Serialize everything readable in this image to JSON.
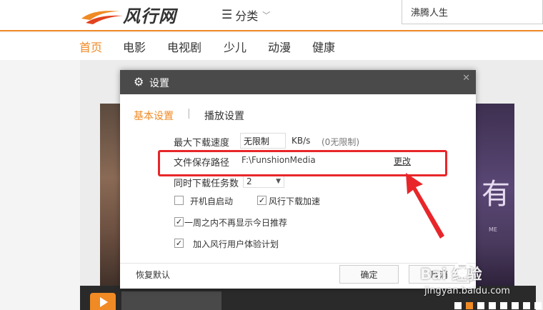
{
  "header": {
    "logo_text": "风行网",
    "category_label": "分类",
    "search_value": "沸腾人生"
  },
  "nav": {
    "items": [
      "首页",
      "电影",
      "电视剧",
      "少儿",
      "动漫",
      "健康"
    ],
    "active": "首页"
  },
  "banner": {
    "poster_calligraphy": "有",
    "poster_sub": "ME"
  },
  "dialog": {
    "title": "设置",
    "tabs": [
      "基本设置",
      "播放设置"
    ],
    "active_tab": "基本设置",
    "max_speed_label": "最大下载速度",
    "max_speed_value": "无限制",
    "speed_unit": "KB/s",
    "speed_hint": "(0无限制)",
    "save_path_label": "文件保存路径",
    "save_path_value": "F:\\FunshionMedia",
    "change_label": "更改",
    "concurrent_label": "同时下载任务数",
    "concurrent_value": "2",
    "checkboxes": [
      {
        "label": "开机自启动",
        "checked": false
      },
      {
        "label": "风行下载加速",
        "checked": true
      },
      {
        "label": "一周之内不再显示今日推荐",
        "checked": true
      },
      {
        "label": "加入风行用户体验计划",
        "checked": true
      }
    ],
    "restore_label": "恢复默认",
    "ok_label": "确定",
    "cancel_label": "取消"
  },
  "watermark": {
    "main": "Bai 经验",
    "sub": "jingyan.baidu.com"
  },
  "colors": {
    "accent": "#f08a24",
    "dialog_title_bg": "#4a4a4a",
    "annotation": "#e8262a"
  }
}
